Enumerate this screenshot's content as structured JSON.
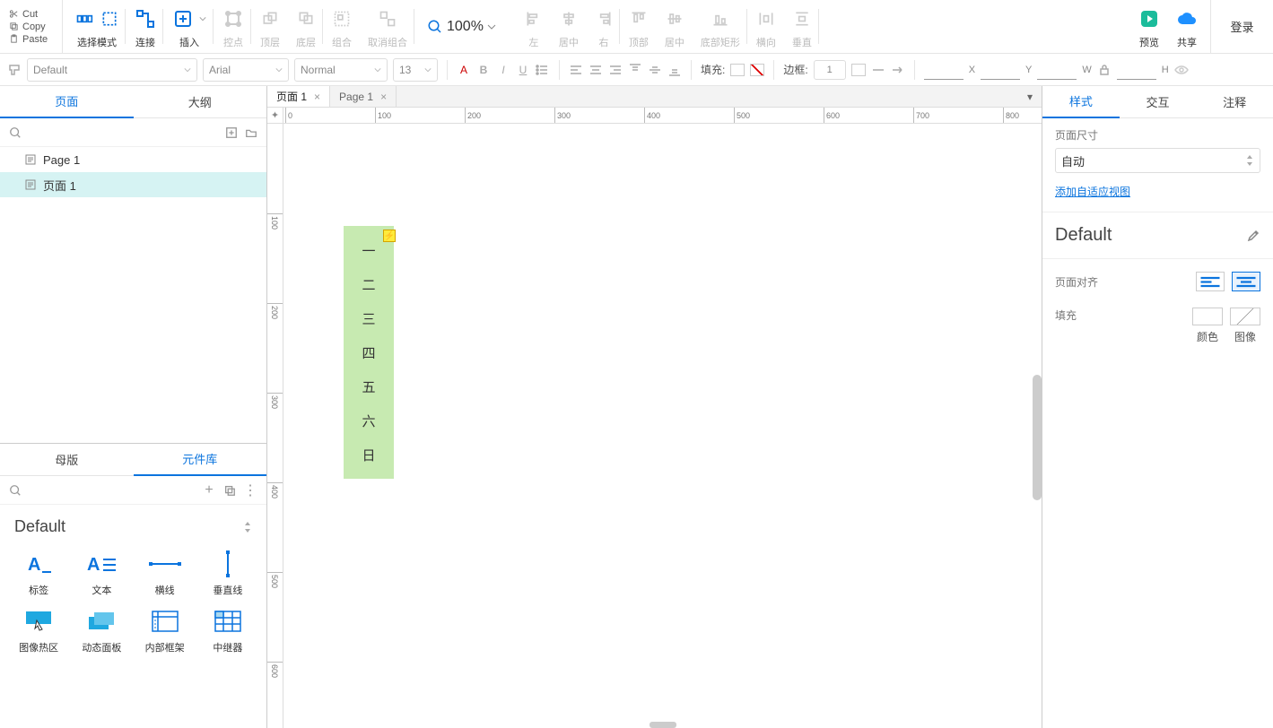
{
  "edit": {
    "cut": "Cut",
    "copy": "Copy",
    "paste": "Paste"
  },
  "ribbon": {
    "select_mode": "选择模式",
    "connect": "连接",
    "insert": "插入",
    "anchor": "控点",
    "front": "顶层",
    "back": "底层",
    "group": "组合",
    "ungroup": "取消组合",
    "zoom_value": "100%",
    "align_left": "左",
    "align_center": "居中",
    "align_right": "右",
    "top": "顶部",
    "middle": "居中",
    "bottom_rect": "底部矩形",
    "dist_h": "横向",
    "dist_v": "垂直",
    "preview": "预览",
    "share": "共享",
    "login": "登录"
  },
  "formatbar": {
    "style": "Default",
    "font": "Arial",
    "weight": "Normal",
    "size": "13",
    "fill_label": "填充:",
    "border_label": "边框:",
    "border_width": "1",
    "pos": {
      "x_label": "X",
      "y_label": "Y",
      "w_label": "W",
      "h_label": "H"
    }
  },
  "left": {
    "tabs": {
      "pages": "页面",
      "outline": "大纲"
    },
    "pages": [
      {
        "name": "Page 1"
      },
      {
        "name": "页面 1"
      }
    ],
    "lib_tabs": {
      "masters": "母版",
      "widgets": "元件库"
    },
    "lib_name": "Default",
    "widgets": [
      {
        "label": "标签"
      },
      {
        "label": "文本"
      },
      {
        "label": "横线"
      },
      {
        "label": "垂直线"
      },
      {
        "label": "图像热区"
      },
      {
        "label": "动态面板"
      },
      {
        "label": "内部框架"
      },
      {
        "label": "中继器"
      }
    ]
  },
  "doc_tabs": [
    {
      "label": "页面 1",
      "active": true
    },
    {
      "label": "Page 1",
      "active": false
    }
  ],
  "ruler_h": [
    0,
    100,
    200,
    300,
    400,
    500,
    600,
    700,
    800
  ],
  "ruler_v": [
    100,
    200,
    300,
    400,
    500,
    600
  ],
  "shape_items": [
    "一",
    "二",
    "三",
    "四",
    "五",
    "六",
    "日"
  ],
  "lightning": "⚡",
  "right": {
    "tabs": {
      "style": "样式",
      "interact": "交互",
      "notes": "注释"
    },
    "page_dim_label": "页面尺寸",
    "page_dim_value": "自动",
    "add_adaptive": "添加自适应视图",
    "default_name": "Default",
    "page_align_label": "页面对齐",
    "fill_label": "填充",
    "fill_opts": {
      "color": "颜色",
      "image": "图像"
    }
  }
}
